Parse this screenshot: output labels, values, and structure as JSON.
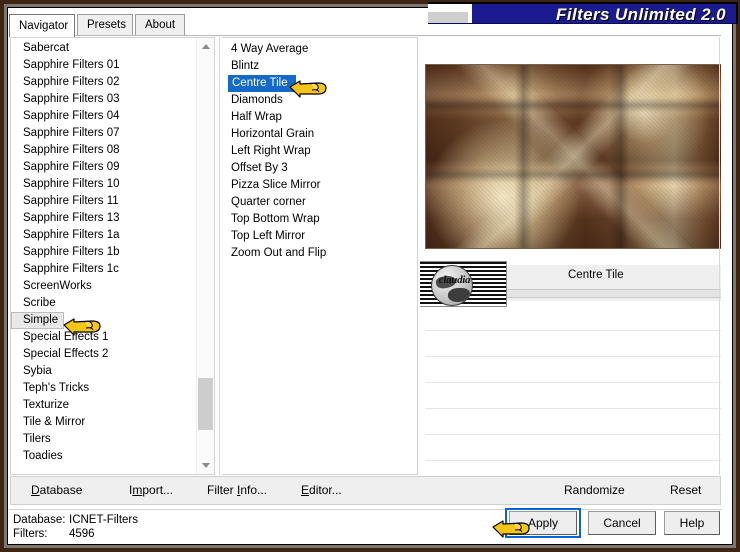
{
  "window": {
    "title": "Filters Unlimited 2.0",
    "accent_navy": "#1b1b8f",
    "frame_color": "#3d2414"
  },
  "tabs": [
    {
      "label": "Navigator",
      "active": true
    },
    {
      "label": "Presets",
      "active": false
    },
    {
      "label": "About",
      "active": false
    }
  ],
  "categories": {
    "selected": "Simple",
    "items": [
      "Sabercat",
      "Sapphire Filters 01",
      "Sapphire Filters 02",
      "Sapphire Filters 03",
      "Sapphire Filters 04",
      "Sapphire Filters 07",
      "Sapphire Filters 08",
      "Sapphire Filters 09",
      "Sapphire Filters 10",
      "Sapphire Filters 11",
      "Sapphire Filters 13",
      "Sapphire Filters 1a",
      "Sapphire Filters 1b",
      "Sapphire Filters 1c",
      "ScreenWorks",
      "Scribe",
      "Simple",
      "Special Effects 1",
      "Special Effects 2",
      "Sybia",
      "Teph's Tricks",
      "Texturize",
      "Tile & Mirror",
      "Tilers",
      "Toadies"
    ]
  },
  "filters": {
    "selected": "Centre Tile",
    "selection_color": "#1569c7",
    "items": [
      "4 Way Average",
      "Blintz",
      "Centre Tile",
      "Diamonds",
      "Half Wrap",
      "Horizontal Grain",
      "Left Right Wrap",
      "Offset By 3",
      "Pizza Slice Mirror",
      "Quarter corner",
      "Top Bottom Wrap",
      "Top Left Mirror",
      "Zoom Out and Flip"
    ]
  },
  "preview": {
    "effect_name": "Centre Tile",
    "thumbnail_label": "claudia"
  },
  "commandbar": {
    "items": [
      {
        "label": "Database",
        "accel": "D"
      },
      {
        "label": "Import...",
        "accel": "m"
      },
      {
        "label": "Filter Info...",
        "accel": "I"
      },
      {
        "label": "Editor...",
        "accel": "E"
      },
      {
        "label": "Randomize",
        "accel": ""
      },
      {
        "label": "Reset",
        "accel": ""
      }
    ]
  },
  "status": {
    "database_key": "Database:",
    "database_value": "ICNET-Filters",
    "filters_key": "Filters:",
    "filters_value": "4596"
  },
  "dialog_buttons": {
    "apply": "Apply",
    "cancel": "Cancel",
    "help": "Help",
    "focus_color": "#0a64d2"
  },
  "cursors": {
    "hand_color": "#f5c518",
    "count": 3
  }
}
